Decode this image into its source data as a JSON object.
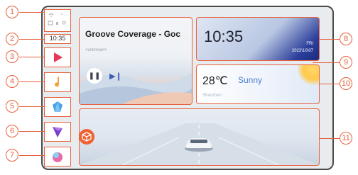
{
  "status": {
    "clock": "10:35"
  },
  "callouts": [
    "1",
    "2",
    "3",
    "4",
    "5",
    "6",
    "7",
    "8",
    "9",
    "10",
    "11"
  ],
  "music": {
    "title": "Groove Coverage - Goc",
    "artist": "<unknown>",
    "pause_icon": "pause-icon",
    "next_icon": "next-icon"
  },
  "time_card": {
    "time": "10:35",
    "day": "FRI",
    "date": "2022\\10\\07"
  },
  "weather": {
    "temp": "28℃",
    "condition": "Sunny",
    "city": "Shenzhen"
  },
  "apps": [
    {
      "name": "play-app-icon",
      "color": "#e8375a"
    },
    {
      "name": "music-note-app-icon",
      "color": "#f0a33a"
    },
    {
      "name": "blue-gem-app-icon",
      "color": "#4aa3e8"
    },
    {
      "name": "purple-app-icon",
      "color": "#7a3ec8"
    },
    {
      "name": "pink-app-icon",
      "color": "#e86aa8"
    }
  ],
  "colors": {
    "callout": "#e8613c",
    "frame": "#4a4a4a"
  }
}
